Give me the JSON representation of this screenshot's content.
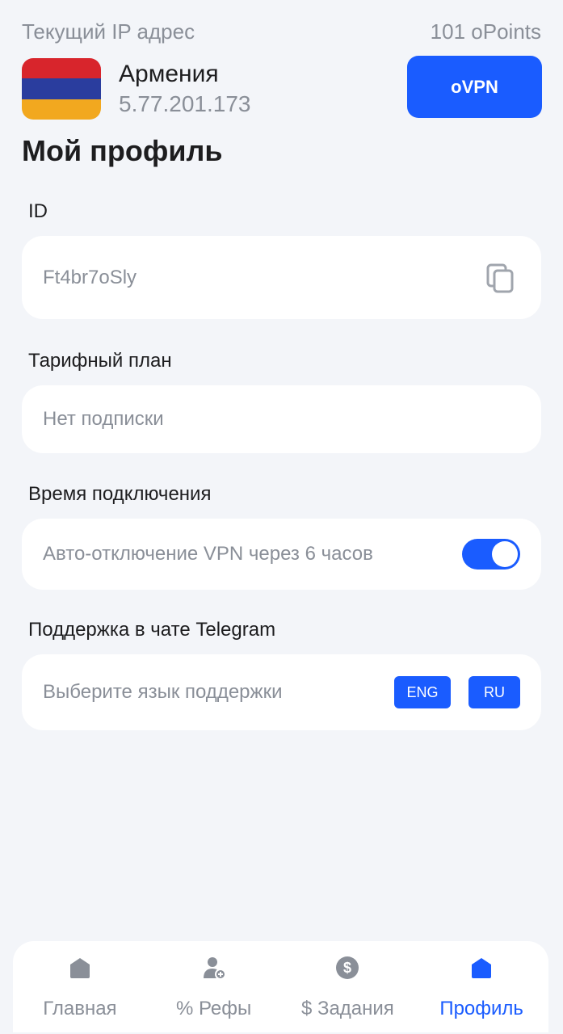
{
  "header": {
    "current_ip_label": "Текущий IP адрес",
    "points": "101 oPoints",
    "country": "Армения",
    "ip_address": "5.77.201.173",
    "vpn_button": "oVPN",
    "flag_colors": [
      "#d8252c",
      "#2a3d9e",
      "#f2a81f"
    ]
  },
  "page_title": "Мой профиль",
  "id_section": {
    "label": "ID",
    "value": "Ft4br7oSly",
    "copy_icon": "copy-icon"
  },
  "plan_section": {
    "label": "Тарифный план",
    "value": "Нет подписки"
  },
  "connection_section": {
    "label": "Время подключения",
    "auto_disconnect_text": "Авто-отключение VPN через 6 часов",
    "toggle_on": true
  },
  "support_section": {
    "label": "Поддержка в чате Telegram",
    "prompt": "Выберите язык поддержки",
    "lang_eng": "ENG",
    "lang_ru": "RU"
  },
  "tabs": [
    {
      "label": "Главная",
      "icon": "home-icon",
      "active": false
    },
    {
      "label": "% Рефы",
      "icon": "user-add-icon",
      "active": false
    },
    {
      "label": "$ Задания",
      "icon": "dollar-icon",
      "active": false
    },
    {
      "label": "Профиль",
      "icon": "home-icon",
      "active": true
    }
  ],
  "colors": {
    "accent": "#1a5cff",
    "background": "#f3f5f9",
    "muted_text": "#8a8f98",
    "inactive_icon": "#8a8f98"
  }
}
